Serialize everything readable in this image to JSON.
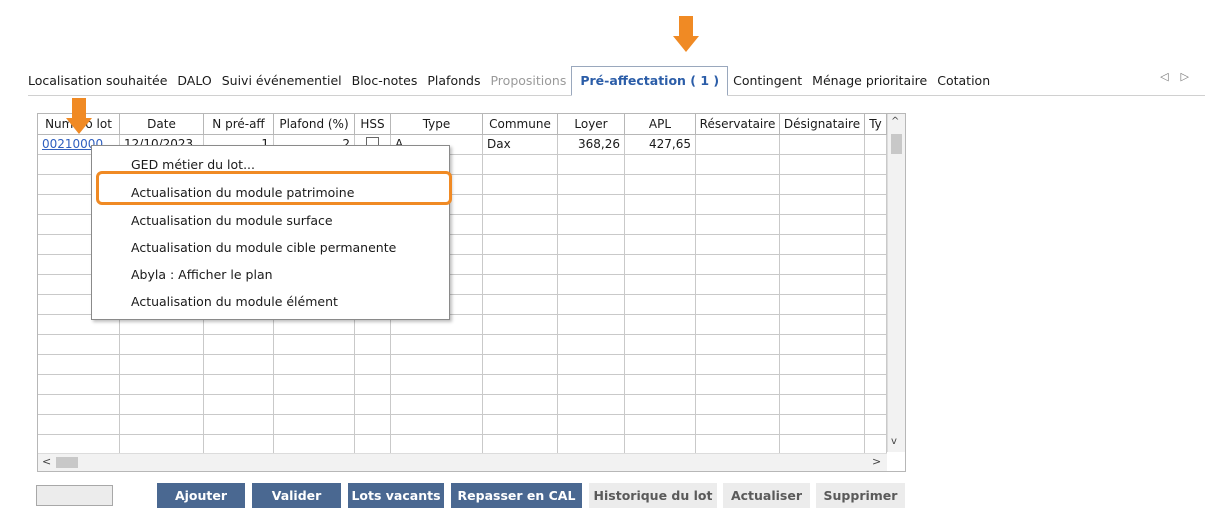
{
  "tabs": [
    {
      "label": "Localisation souhaitée",
      "state": "normal"
    },
    {
      "label": "DALO",
      "state": "normal"
    },
    {
      "label": "Suivi événementiel",
      "state": "normal"
    },
    {
      "label": "Bloc-notes",
      "state": "normal"
    },
    {
      "label": "Plafonds",
      "state": "normal"
    },
    {
      "label": "Propositions",
      "state": "disabled"
    },
    {
      "label": "Pré-affectation ( 1 )",
      "state": "active"
    },
    {
      "label": "Contingent",
      "state": "normal"
    },
    {
      "label": "Ménage prioritaire",
      "state": "normal"
    },
    {
      "label": "Cotation",
      "state": "normal"
    }
  ],
  "tab_nav": {
    "prev": "◁",
    "next": "▷"
  },
  "grid": {
    "columns": [
      "Numéro lot",
      "Date",
      "N pré-aff",
      "Plafond (%)",
      "HSS",
      "Type",
      "Commune",
      "Loyer",
      "APL",
      "Réservataire",
      "Désignataire",
      "Ty"
    ],
    "row": {
      "numero_lot": "00210000",
      "date": "12/10/2023",
      "n_pre_aff": "1",
      "plafond": "2",
      "type": "A..",
      "commune": "Dax",
      "loyer": "368,26",
      "apl": "427,65"
    },
    "scroll": {
      "up": "^",
      "down": "v",
      "left": "<",
      "right": ">"
    }
  },
  "context_menu": [
    {
      "label": "GED métier du lot..."
    },
    {
      "label": "Actualisation du module patrimoine"
    },
    {
      "label": "Actualisation du module surface"
    },
    {
      "label": "Actualisation du module cible permanente"
    },
    {
      "label": "Abyla : Afficher le plan"
    },
    {
      "label": "Actualisation du module élément"
    }
  ],
  "buttons": [
    {
      "label": "Ajouter",
      "state": "enabled"
    },
    {
      "label": "Valider",
      "state": "enabled"
    },
    {
      "label": "Lots vacants",
      "state": "enabled"
    },
    {
      "label": "Repasser en CAL",
      "state": "enabled"
    },
    {
      "label": "Historique du lot",
      "state": "disabled"
    },
    {
      "label": "Actualiser",
      "state": "disabled"
    },
    {
      "label": "Supprimer",
      "state": "disabled"
    }
  ],
  "colors": {
    "accent_orange": "#f08a24",
    "active_tab": "#2b5da8",
    "button_primary": "#4a6891",
    "link": "#2f5fbf"
  }
}
